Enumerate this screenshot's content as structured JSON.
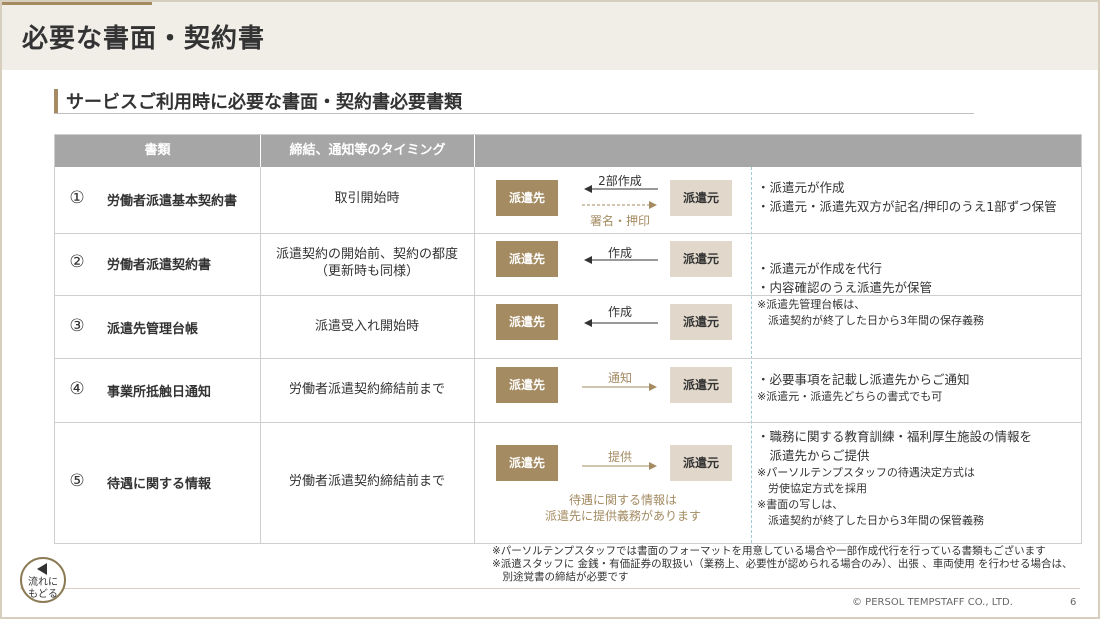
{
  "page": {
    "title": "必要な書面・契約書",
    "section_title": "サービスご利用時に必要な書面・契約書必要書類"
  },
  "table": {
    "headers": [
      "書類",
      "締結、通知等のタイミング"
    ],
    "rows": [
      {
        "num": "①",
        "doc": "労働者派遣基本契約書",
        "timing": "取引開始時",
        "left": "派遣先",
        "right": "派遣元",
        "arrow_top": "2部作成",
        "arrow_bottom": "署名・押印",
        "desc": [
          "・派遣元が作成",
          "・派遣元・派遣先双方が記名/押印のうえ1部ずつ保管"
        ]
      },
      {
        "num": "②",
        "doc": "労働者派遣契約書",
        "timing": "派遣契約の開始前、契約の都度\n（更新時も同様）",
        "left": "派遣先",
        "right": "派遣元",
        "arrow_top": "作成"
      },
      {
        "num": "③",
        "doc": "派遣先管理台帳",
        "timing": "派遣受入れ開始時",
        "left": "派遣先",
        "right": "派遣元",
        "arrow_top": "作成"
      },
      {
        "num": "④",
        "doc": "事業所抵触日通知",
        "timing": "労働者派遣契約締結前まで",
        "left": "派遣先",
        "right": "派遣元",
        "arrow_top": "通知",
        "desc": [
          "・必要事項を記載し派遣先からご通知"
        ],
        "desc_small": [
          "※派遣元・派遣先どちらの書式でも可"
        ]
      },
      {
        "num": "⑤",
        "doc": "待遇に関する情報",
        "timing": "労働者派遣契約締結前まで",
        "left": "派遣先",
        "right": "派遣元",
        "arrow_top": "提供",
        "note": "待遇に関する情報は\n派遣先に提供義務があります",
        "desc": [
          "・職務に関する教育訓練・福利厚生施設の情報を",
          "　派遣先からご提供"
        ],
        "desc_small": [
          "※パーソルテンプスタッフの待遇決定方式は",
          "　労使協定方式を採用",
          "※書面の写しは、",
          "　派遣契約が終了した日から3年間の保管義務"
        ]
      }
    ],
    "desc_2_3": [
      "・派遣元が作成を代行",
      "・内容確認のうえ派遣先が保管"
    ],
    "desc_2_3_small": [
      "※派遣先管理台帳は、",
      "　派遣契約が終了した日から3年間の保存義務"
    ]
  },
  "footnotes": [
    "※パーソルテンプスタッフでは書面のフォーマットを用意している場合や一部作成代行を行っている書類もございます",
    "※派遣スタッフに 金銭・有価証券の取扱い（業務上、必要性が認められる場合のみ）、出張 、車両使用 を行わせる場合は、",
    "　別途覚書の締結が必要です"
  ],
  "copyright": "© PERSOL TEMPSTAFF CO., LTD.",
  "page_number": "6",
  "back_button": {
    "line1": "流れに",
    "line2": "もどる"
  },
  "colors": {
    "accent": "#a48b62",
    "light": "#e1d8cb",
    "header_bg": "#f1eee8"
  }
}
